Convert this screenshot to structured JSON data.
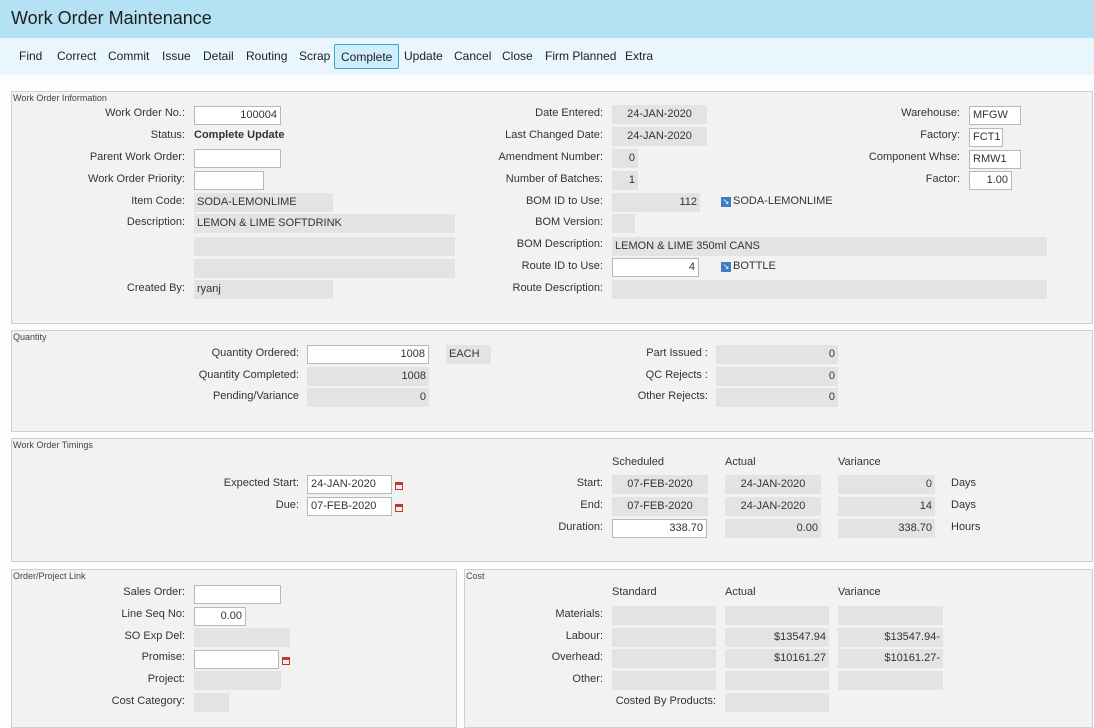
{
  "window": {
    "title": "Work Order Maintenance"
  },
  "menu": {
    "find": "Find",
    "correct": "Correct",
    "commit": "Commit",
    "issue": "Issue",
    "detail": "Detail",
    "routing": "Routing",
    "scrap": "Scrap",
    "complete": "Complete",
    "update": "Update",
    "cancel": "Cancel",
    "close": "Close",
    "firm_planned": "Firm Planned",
    "extra": "Extra"
  },
  "info": {
    "legend": "Work Order Information",
    "work_order_no_label": "Work Order No.:",
    "work_order_no": "100004",
    "status_label": "Status:",
    "status": "Complete Update",
    "parent_wo_label": "Parent Work Order:",
    "parent_wo": "",
    "priority_label": "Work Order Priority:",
    "priority": "",
    "item_code_label": "Item Code:",
    "item_code": "SODA-LEMONLIME",
    "description_label": "Description:",
    "description": "LEMON & LIME SOFTDRINK",
    "description2": "",
    "description3": "",
    "created_by_label": "Created By:",
    "created_by": "ryanj",
    "date_entered_label": "Date Entered:",
    "date_entered": "24-JAN-2020",
    "last_changed_label": "Last Changed Date:",
    "last_changed": "24-JAN-2020",
    "amendment_label": "Amendment Number:",
    "amendment": "0",
    "batches_label": "Number of Batches:",
    "batches": "1",
    "bom_id_label": "BOM ID to Use:",
    "bom_id": "112",
    "bom_link": "SODA-LEMONLIME",
    "bom_version_label": "BOM Version:",
    "bom_version": "",
    "bom_desc_label": "BOM Description:",
    "bom_desc": "LEMON & LIME 350ml CANS",
    "route_id_label": "Route ID to Use:",
    "route_id": "4",
    "route_link": "BOTTLE",
    "route_desc_label": "Route Description:",
    "route_desc": "",
    "warehouse_label": "Warehouse:",
    "warehouse": "MFGW",
    "factory_label": "Factory:",
    "factory": "FCT1",
    "component_whse_label": "Component Whse:",
    "component_whse": "RMW1",
    "factor_label": "Factor:",
    "factor": "1.00"
  },
  "quantity": {
    "legend": "Quantity",
    "ordered_label": "Quantity Ordered:",
    "ordered": "1008",
    "uom": "EACH",
    "completed_label": "Quantity Completed:",
    "completed": "1008",
    "pending_label": "Pending/Variance",
    "pending": "0",
    "part_issued_label": "Part Issued :",
    "part_issued": "0",
    "qc_rejects_label": "QC Rejects :",
    "qc_rejects": "0",
    "other_rejects_label": "Other Rejects:",
    "other_rejects": "0"
  },
  "timings": {
    "legend": "Work Order Timings",
    "expected_start_label": "Expected Start:",
    "expected_start": "24-JAN-2020",
    "due_label": "Due:",
    "due": "07-FEB-2020",
    "col_scheduled": "Scheduled",
    "col_actual": "Actual",
    "col_variance": "Variance",
    "start_label": "Start:",
    "start_sched": "07-FEB-2020",
    "start_actual": "24-JAN-2020",
    "start_var": "0",
    "start_unit": "Days",
    "end_label": "End:",
    "end_sched": "07-FEB-2020",
    "end_actual": "24-JAN-2020",
    "end_var": "14",
    "end_unit": "Days",
    "duration_label": "Duration:",
    "duration_sched": "338.70",
    "duration_actual": "0.00",
    "duration_var": "338.70",
    "duration_unit": "Hours"
  },
  "order_link": {
    "legend": "Order/Project Link",
    "sales_order_label": "Sales Order:",
    "sales_order": "",
    "line_seq_label": "Line Seq No:",
    "line_seq": "0.00",
    "so_exp_del_label": "SO Exp Del:",
    "so_exp_del": "",
    "promise_label": "Promise:",
    "promise": "",
    "project_label": "Project:",
    "project": "",
    "cost_category_label": "Cost Category:",
    "cost_category": ""
  },
  "cost": {
    "legend": "Cost",
    "col_standard": "Standard",
    "col_actual": "Actual",
    "col_variance": "Variance",
    "materials_label": "Materials:",
    "materials_std": "",
    "materials_act": "",
    "materials_var": "",
    "labour_label": "Labour:",
    "labour_std": "",
    "labour_act": "$13547.94",
    "labour_var": "$13547.94-",
    "overhead_label": "Overhead:",
    "overhead_std": "",
    "overhead_act": "$10161.27",
    "overhead_var": "$10161.27-",
    "other_label": "Other:",
    "other_std": "",
    "other_act": "",
    "other_var": "",
    "costed_by_products_label": "Costed By Products:",
    "costed_by_products": ""
  }
}
